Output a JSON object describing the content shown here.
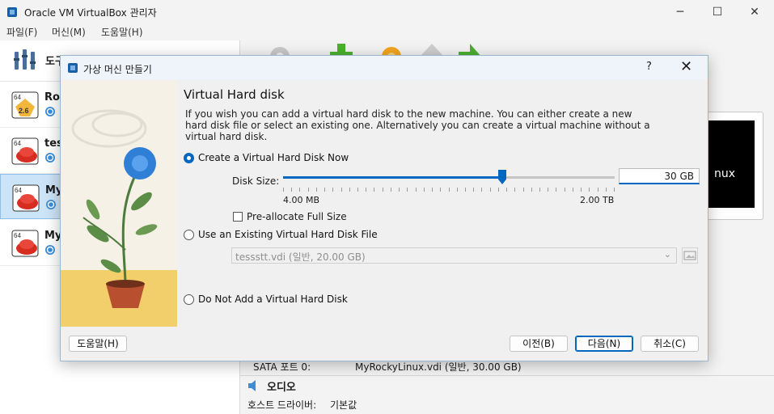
{
  "window": {
    "title": "Oracle VM VirtualBox 관리자",
    "controls": {
      "minimize": "─",
      "maximize": "☐",
      "close": "✕"
    }
  },
  "menu": [
    "파일(F)",
    "머신(M)",
    "도움말(H)"
  ],
  "sidebar": {
    "tools_label": "도구",
    "vms": [
      {
        "name": "Ro",
        "badge": "2.6",
        "os": "64"
      },
      {
        "name": "tes",
        "os": "64"
      },
      {
        "name": "My",
        "os": "64",
        "selected": true
      },
      {
        "name": "My",
        "os": "64"
      }
    ]
  },
  "preview": {
    "text": "nux"
  },
  "details": {
    "sata_label": "SATA 포트 0:",
    "sata_value": "MyRockyLinux.vdi (일반, 30.00 GB)",
    "audio_title": "오디오",
    "host_driver_label": "호스트 드라이버:",
    "host_driver_value": "기본값"
  },
  "dialog": {
    "title": "가상 머신 만들기",
    "help": "?",
    "close": "✕",
    "page_title": "Virtual Hard disk",
    "description": "If you wish you can add a virtual hard disk to the new machine. You can either create a new hard disk file or select an existing one. Alternatively you can create a virtual machine without a virtual hard disk.",
    "option_create": "Create a Virtual Hard Disk Now",
    "disk_size_label": "Disk Size:",
    "disk_size_value": "30",
    "disk_size_unit": "GB",
    "slider_level": 0.66,
    "slider_min": "4.00 MB",
    "slider_max": "2.00 TB",
    "preallocate_label": "Pre-allocate Full Size",
    "option_existing": "Use an Existing Virtual Hard Disk File",
    "existing_file": "tessstt.vdi (일반, 20.00 GB)",
    "option_none": "Do Not Add a Virtual Hard Disk",
    "buttons": {
      "help": "도움말(H)",
      "back": "이전(B)",
      "next": "다음(N)",
      "cancel": "취소(C)"
    }
  },
  "colors": {
    "accent": "#0067c0",
    "selection": "#cce4f7"
  }
}
